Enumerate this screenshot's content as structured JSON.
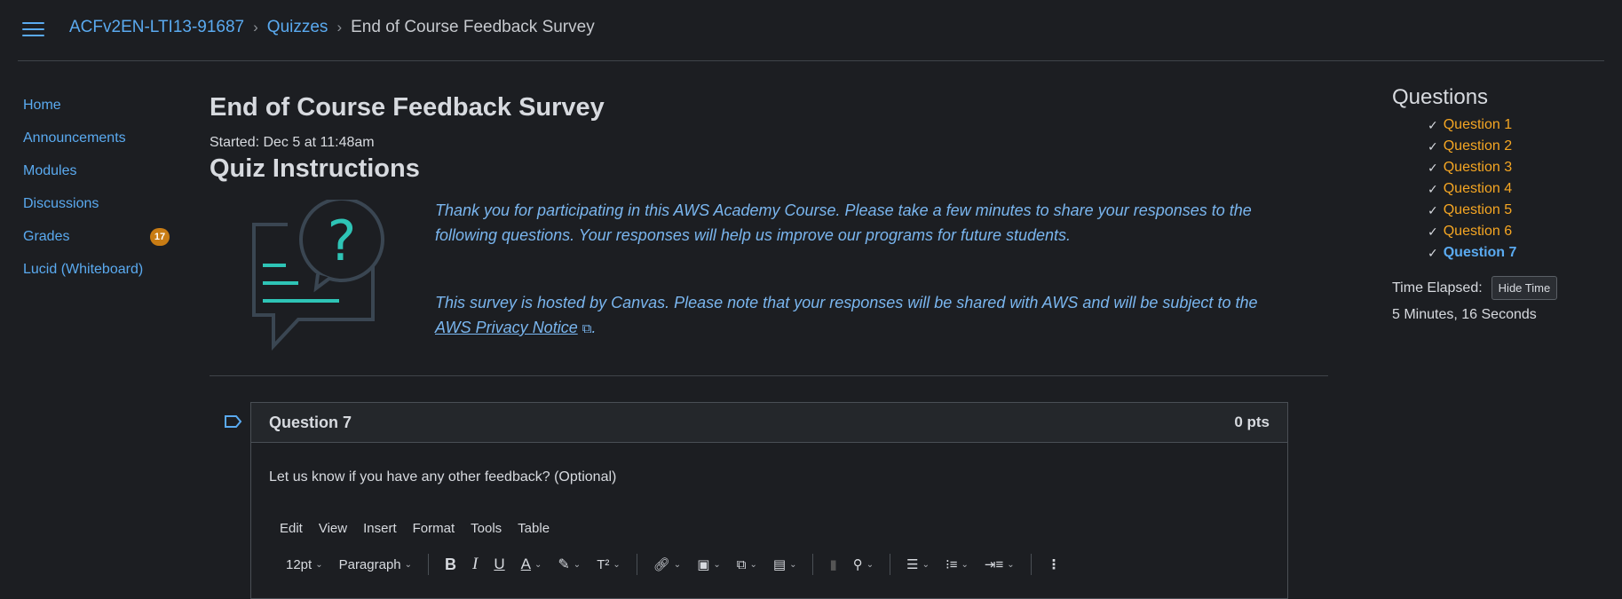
{
  "breadcrumb": {
    "course": "ACFv2EN-LTI13-91687",
    "section": "Quizzes",
    "current": "End of Course Feedback Survey"
  },
  "nav": [
    {
      "label": "Home"
    },
    {
      "label": "Announcements"
    },
    {
      "label": "Modules"
    },
    {
      "label": "Discussions"
    },
    {
      "label": "Grades",
      "badge": "17"
    },
    {
      "label": "Lucid (Whiteboard)"
    }
  ],
  "quiz": {
    "title": "End of Course Feedback Survey",
    "started": "Started: Dec 5 at 11:48am",
    "instructions_heading": "Quiz Instructions",
    "para1": "Thank you for participating in this AWS Academy Course. Please take a few minutes to share your responses to the following questions. Your responses will help us improve our programs for future students.",
    "para2": "This survey is hosted by Canvas. Please note that your responses will be shared with AWS and will be subject to the",
    "privacy_link": "AWS Privacy Notice",
    "period": "."
  },
  "question": {
    "title": "Question 7",
    "points": "0 pts",
    "text": "Let us know if you have any other feedback? (Optional)",
    "menu": [
      "Edit",
      "View",
      "Insert",
      "Format",
      "Tools",
      "Table"
    ],
    "font_size": "12pt",
    "block_format": "Paragraph"
  },
  "sidebar": {
    "heading": "Questions",
    "questions": [
      "Question 1",
      "Question 2",
      "Question 3",
      "Question 4",
      "Question 5",
      "Question 6",
      "Question 7"
    ],
    "time_label": "Time Elapsed:",
    "hide_time": "Hide Time",
    "elapsed": "5 Minutes, 16 Seconds"
  },
  "colors": {
    "link": "#5aaaf0",
    "answered": "#f5a623",
    "background": "#1c1e22",
    "badge": "#c87c14"
  }
}
